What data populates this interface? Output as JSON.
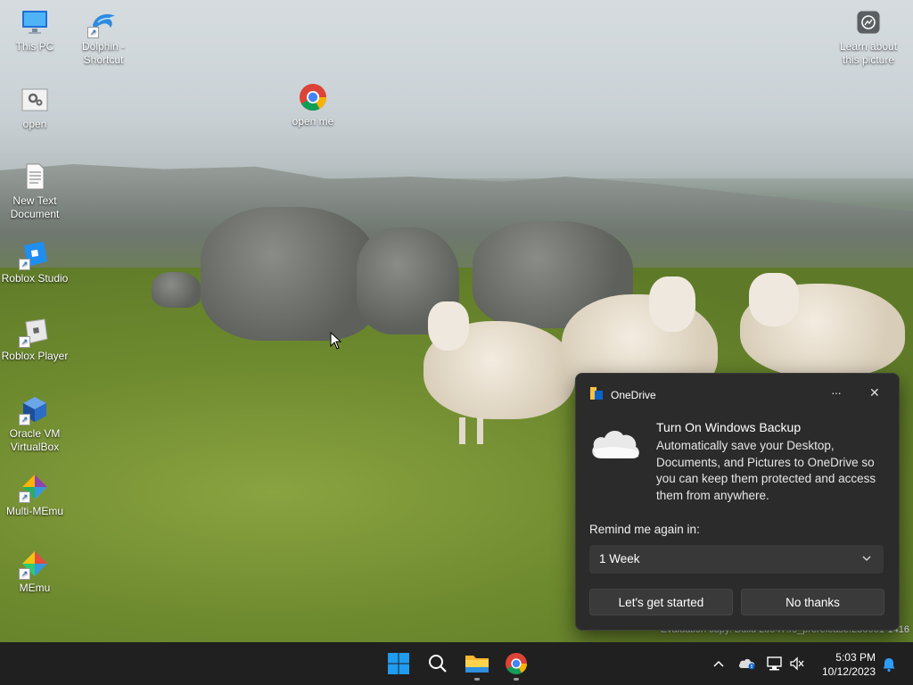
{
  "desktop_icons": [
    {
      "label": "This PC",
      "icon": "monitor-icon"
    },
    {
      "label": "Dolphin -\nShortcut",
      "icon": "dolphin-icon"
    },
    {
      "label": "open",
      "icon": "settings-file-icon"
    },
    {
      "label": "open me",
      "icon": "chrome-icon"
    },
    {
      "label": "New Text\nDocument",
      "icon": "text-document-icon"
    },
    {
      "label": "Roblox Studio",
      "icon": "roblox-studio-icon"
    },
    {
      "label": "Roblox Player",
      "icon": "roblox-player-icon"
    },
    {
      "label": "Oracle VM\nVirtualBox",
      "icon": "virtualbox-icon"
    },
    {
      "label": "Multi-MEmu",
      "icon": "multi-memu-icon"
    },
    {
      "label": "MEmu",
      "icon": "memu-icon"
    },
    {
      "label": "Learn about\nthis picture",
      "icon": "spotlight-icon"
    }
  ],
  "watermark": "Evaluation copy. Build 25947.rs_prerelease.230901-1416",
  "onedrive": {
    "app_name": "OneDrive",
    "more_glyph": "···",
    "close_glyph": "✕",
    "title": "Turn On Windows Backup",
    "body": "Automatically save your Desktop, Documents, and Pictures to OneDrive so you can keep them protected and access them from anywhere.",
    "remind_label": "Remind me again in:",
    "selected_option": "1 Week",
    "primary_button": "Let's get started",
    "secondary_button": "No thanks"
  },
  "taskbar": {
    "time": "5:03 PM",
    "date": "10/12/2023",
    "apps": [
      "start-icon",
      "search-icon",
      "file-explorer-icon",
      "chrome-icon"
    ],
    "tray": [
      "chevron-up-icon",
      "onedrive-icon",
      "network-icon",
      "volume-mute-icon",
      "notification-bell-icon"
    ]
  }
}
